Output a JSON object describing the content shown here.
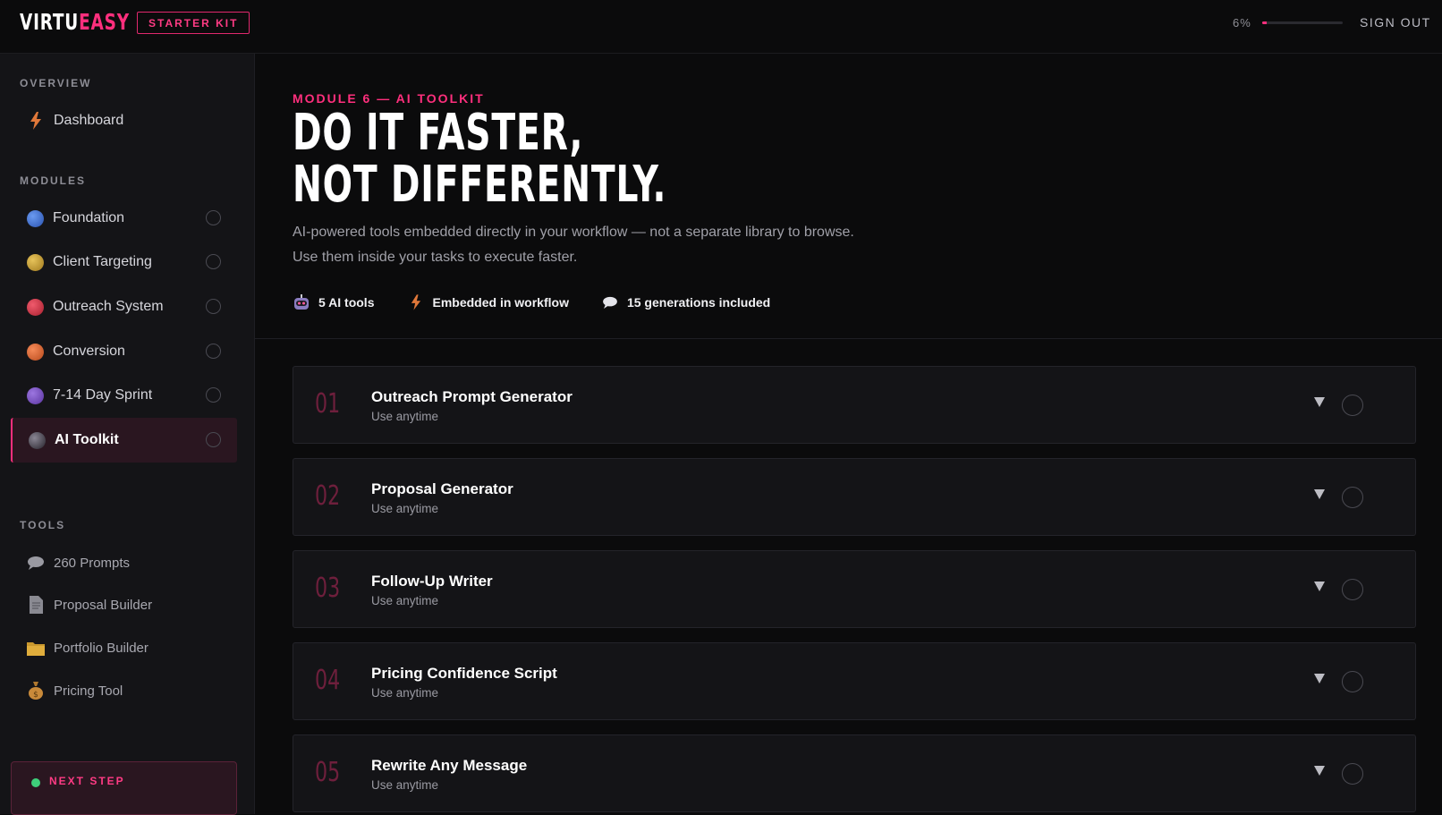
{
  "brand": {
    "logo_part1": "VIRTU",
    "logo_part2": "EASY",
    "badge": "STARTER KIT",
    "accent": "#ff2f7d"
  },
  "header": {
    "progress_label": "6%",
    "progress_value": 0.06,
    "signout": "SIGN OUT"
  },
  "sidebar": {
    "overview_label": "OVERVIEW",
    "dashboard": "Dashboard",
    "modules_label": "MODULES",
    "modules": [
      {
        "label": "Foundation",
        "color": "#3b6fd6"
      },
      {
        "label": "Client Targeting",
        "color": "#c9a13a"
      },
      {
        "label": "Outreach System",
        "color": "#d83a4e"
      },
      {
        "label": "Conversion",
        "color": "#e06a38"
      },
      {
        "label": "7-14 Day Sprint",
        "color": "#7b4fc4"
      },
      {
        "label": "AI Toolkit",
        "color": "#4a4652",
        "active": true
      }
    ],
    "tools_label": "TOOLS",
    "tools": [
      {
        "label": "260 Prompts",
        "icon": "speech-bubble-icon"
      },
      {
        "label": "Proposal Builder",
        "icon": "document-icon"
      },
      {
        "label": "Portfolio Builder",
        "icon": "folder-icon"
      },
      {
        "label": "Pricing Tool",
        "icon": "money-bag-icon"
      }
    ],
    "next_step": "NEXT STEP"
  },
  "main": {
    "kicker": "MODULE 6 — AI TOOLKIT",
    "headline_line1": "DO IT FASTER,",
    "headline_line2": "NOT DIFFERENTLY.",
    "desc_line1": "AI-powered tools embedded directly in your workflow — not a separate library to browse.",
    "desc_line2": "Use them inside your tasks to execute faster.",
    "features": [
      {
        "label": "5 AI tools",
        "icon": "robot-icon"
      },
      {
        "label": "Embedded in workflow",
        "icon": "lightning-icon"
      },
      {
        "label": "15 generations included",
        "icon": "speech-bubble-icon"
      }
    ],
    "tools": [
      {
        "num": "01",
        "title": "Outreach Prompt Generator",
        "subtitle": "Use anytime"
      },
      {
        "num": "02",
        "title": "Proposal Generator",
        "subtitle": "Use anytime"
      },
      {
        "num": "03",
        "title": "Follow-Up Writer",
        "subtitle": "Use anytime"
      },
      {
        "num": "04",
        "title": "Pricing Confidence Script",
        "subtitle": "Use anytime"
      },
      {
        "num": "05",
        "title": "Rewrite Any Message",
        "subtitle": "Use anytime"
      }
    ]
  }
}
